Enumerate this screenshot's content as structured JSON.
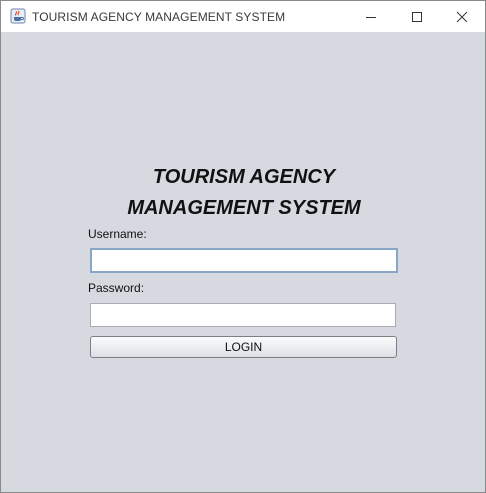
{
  "window": {
    "title": "TOURISM AGENCY MANAGEMENT SYSTEM",
    "icon": "java-cup-icon",
    "controls": [
      "minimize-icon",
      "maximize-icon",
      "close-icon"
    ]
  },
  "login_form": {
    "heading_line1": "TOURISM AGENCY",
    "heading_line2": "MANAGEMENT SYSTEM",
    "username_label": "Username:",
    "username_value": "",
    "password_label": "Password:",
    "password_value": "",
    "login_button_label": "LOGIN"
  },
  "colors": {
    "background": "#d6d9e0",
    "titlebar": "#ffffff",
    "focus_border": "#8aa6c6"
  }
}
